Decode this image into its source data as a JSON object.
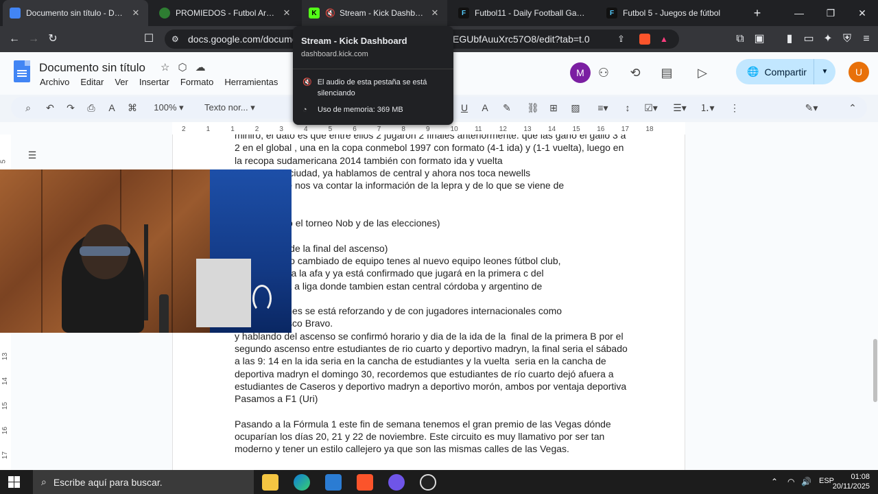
{
  "browser": {
    "tabs": [
      {
        "title": "Documento sin título - Docum",
        "favicon_color": "#4285f4",
        "active": true
      },
      {
        "title": "PROMIEDOS - Futbol Argentino -",
        "favicon_color": "#2e7d32",
        "active": false
      },
      {
        "title": "Stream - Kick Dashboard",
        "favicon_color": "#53fc18",
        "active": false
      },
      {
        "title": "Futbol11 - Daily Football Games",
        "favicon_color": "#111111",
        "active": false
      },
      {
        "title": "Futbol 5 - Juegos de fútbol",
        "favicon_color": "#111111",
        "active": false
      }
    ],
    "url_start": "docs.google.com/docume",
    "url_end": "EGUbfAuuXrc57O8/edit?tab=t.0",
    "hovercard": {
      "title": "Stream - Kick Dashboard",
      "domain": "dashboard.kick.com",
      "audio": "El audio de esta pestaña se está silenciando",
      "memory": "Uso de memoria: 369 MB"
    }
  },
  "docs": {
    "title": "Documento sin título",
    "menu": [
      "Archivo",
      "Editar",
      "Ver",
      "Insertar",
      "Formato",
      "Herramientas"
    ],
    "avatar_m": "M",
    "avatar_u": "U",
    "share_label": "Compartir",
    "zoom": "100%",
    "style": "Texto nor...",
    "ruler_ticks": [
      "2",
      "1",
      "1",
      "2",
      "3",
      "4",
      "5",
      "6",
      "7",
      "8",
      "9",
      "10",
      "11",
      "12",
      "13",
      "14",
      "15",
      "16",
      "17",
      "18"
    ],
    "vruler_ticks": [
      "5",
      "13",
      "14",
      "15",
      "16",
      "17"
    ],
    "body_lines": [
      "mihiro, el dato es que entre ellos 2 jugaron 2 finales anteriormente. que las ganó el gallo 3 a",
      "2 en el global , una en la copa conmebol 1997 con formato (4-1 ida) y (1-1 vuelta), luego en",
      "la recopa sudamericana 2014 también con formato ida y vuelta",
      "misma de la ciudad, ya hablamos de central y ahora nos toca newells",
      "está mati que nos va contar la información de la lepra y de lo que se viene de",
      "elecciones",
      "",
      "el cómo cerró el torneo Nob y de las elecciones)",
      "",
      "de Leones y de la final del ascenso)",
      "la ciudad pero cambiado de equipo tenes al nuevo equipo leones fútbol club,",
      "ente se afilió a la afa y ya está confirmado que jugará en la primera c del",
      "no y se suma a liga donde tambien estan central córdoba y argentino de",
      "",
      "mos que leones se está reforzando y de con jugadores internacionales como",
      "biano Francisco Bravo.",
      "y hablando del ascenso se confirmó horario y dia de la ida de la  final de la primera B por el",
      "segundo ascenso entre estudiantes de rio cuarto y deportivo madryn, la final seria el sábado",
      "a las 9: 14 en la ida seria en la cancha de estudiantes y la vuelta  seria en la cancha de",
      "deportiva madryn el domingo 30, recordemos que estudiantes de río cuarto dejó afuera a",
      "estudiantes de Caseros y deportivo madryn a deportivo morón, ambos por ventaja deportiva",
      "Pasamos a F1 (Uri)",
      "",
      "Pasando a la Fórmula 1 este fin de semana tenemos el gran premio de las Vegas dónde",
      "ocuparían los días 20, 21 y 22 de noviembre. Este circuito es muy llamativo por ser tan",
      "moderno y tener un estilo callejero ya que son las mismas calles de las Vegas."
    ]
  },
  "taskbar": {
    "search_placeholder": "Escribe aquí para buscar.",
    "lang": "ESP",
    "time": "01:08",
    "date": "20/11/2025"
  }
}
